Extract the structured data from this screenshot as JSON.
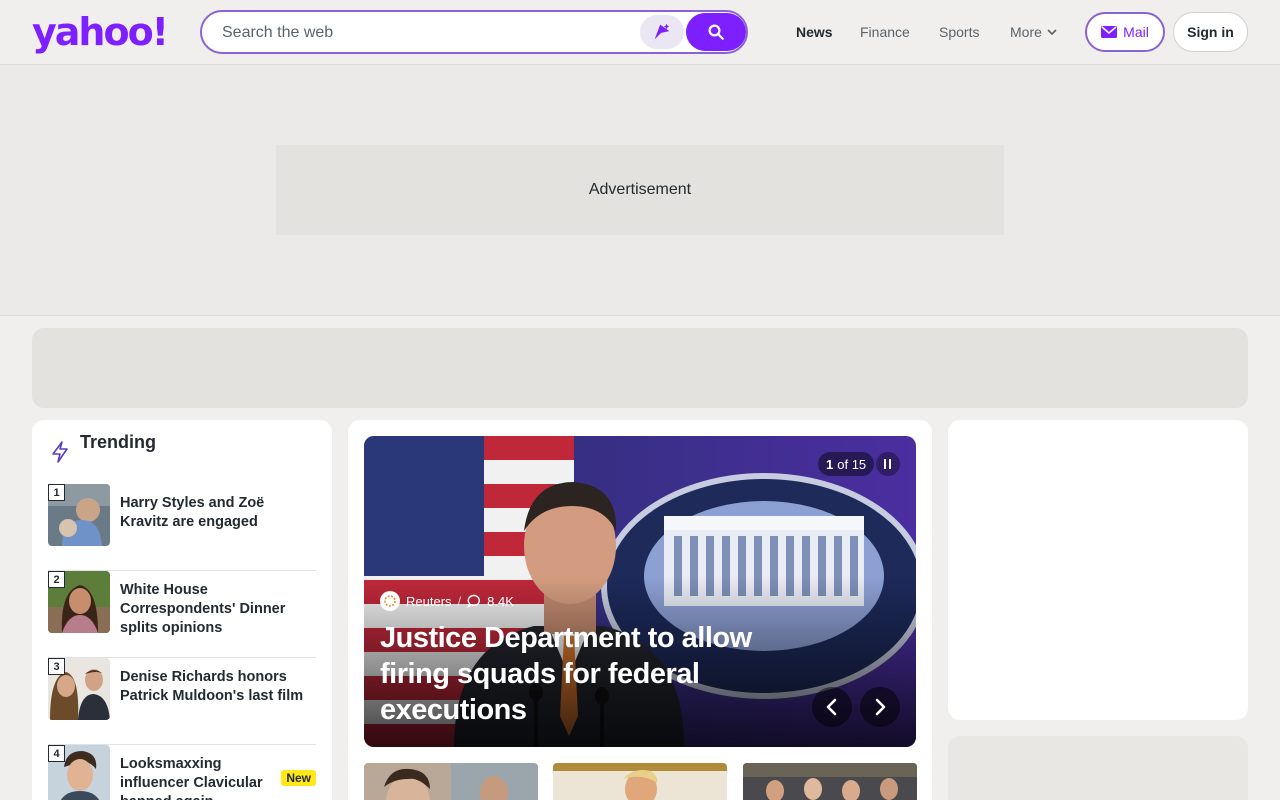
{
  "header": {
    "logo": "yahoo!",
    "search": {
      "placeholder": "Search the web"
    },
    "nav": [
      "News",
      "Finance",
      "Sports",
      "More"
    ],
    "mail_label": "Mail",
    "signin_label": "Sign in"
  },
  "ad": {
    "label": "Advertisement"
  },
  "trending": {
    "title": "Trending",
    "items": [
      {
        "rank": "1",
        "title": "Harry Styles and Zoë Kravitz are engaged"
      },
      {
        "rank": "2",
        "title": "White House Correspondents' Dinner splits opinions"
      },
      {
        "rank": "3",
        "title": "Denise Richards honors Patrick Muldoon's last film"
      },
      {
        "rank": "4",
        "title": "Looksmaxxing influencer Clavicular banned again",
        "badge": "New"
      }
    ]
  },
  "hero": {
    "counter_current": "1",
    "counter_total": "of 15",
    "source": "Reuters",
    "comments": "8.4K",
    "title": "Justice Department to allow firing squads for federal executions"
  },
  "colors": {
    "brand": "#7e1fff",
    "accent_border": "#8a63d2",
    "new_badge": "#ffe817"
  }
}
